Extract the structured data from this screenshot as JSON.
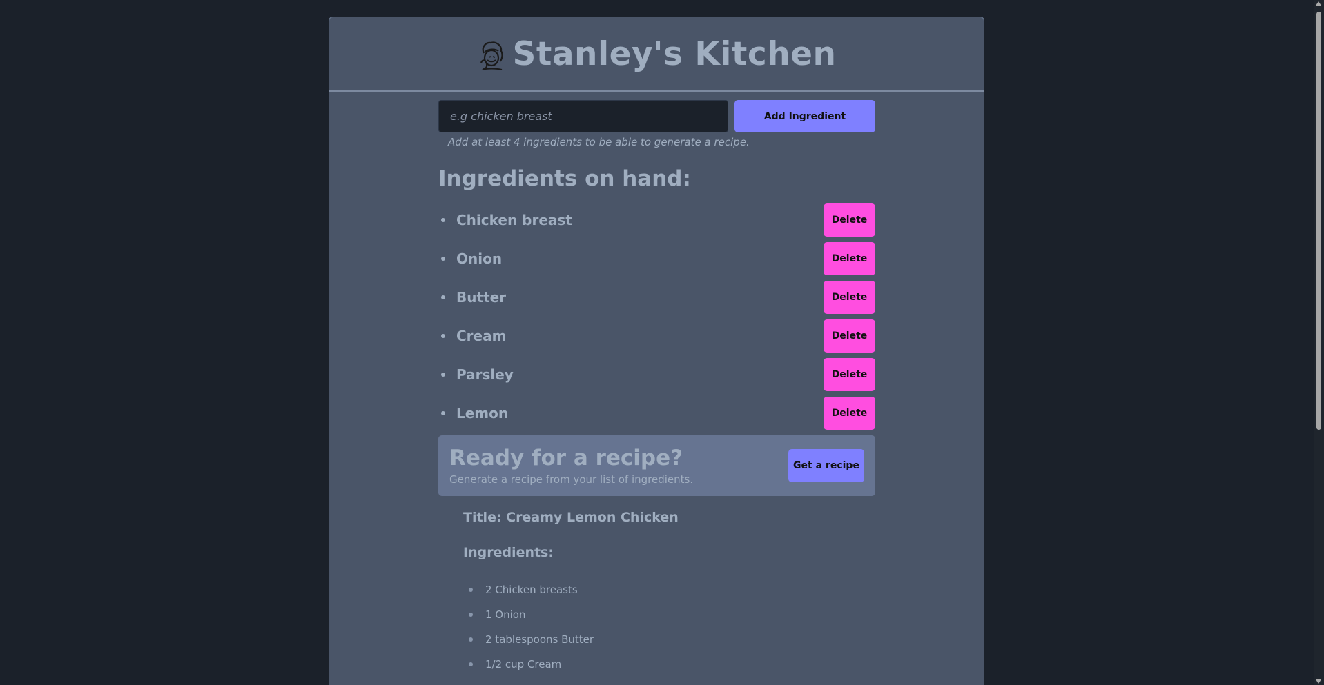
{
  "header": {
    "title": "Stanley's Kitchen",
    "logo_icon": "chef-icon"
  },
  "add_form": {
    "placeholder": "e.g chicken breast",
    "value": "",
    "button_label": "Add Ingredient",
    "hint": "Add at least 4 ingredients to be able to generate a recipe."
  },
  "ingredients": {
    "heading": "Ingredients on hand:",
    "delete_label": "Delete",
    "items": [
      {
        "name": "Chicken breast"
      },
      {
        "name": "Onion"
      },
      {
        "name": "Butter"
      },
      {
        "name": "Cream"
      },
      {
        "name": "Parsley"
      },
      {
        "name": "Lemon"
      }
    ]
  },
  "ready": {
    "title": "Ready for a recipe?",
    "subtitle": "Generate a recipe from your list of ingredients.",
    "button_label": "Get a recipe"
  },
  "recipe": {
    "title": "Title: Creamy Lemon Chicken",
    "ingredients_heading": "Ingredients:",
    "ingredients": [
      "2 Chicken breasts",
      "1 Onion",
      "2 tablespoons Butter",
      "1/2 cup Cream"
    ]
  },
  "colors": {
    "page_bg": "#1b212a",
    "card_bg": "#4a5568",
    "text": "#a0aec0",
    "primary_button": "#7f80ff",
    "delete_button": "#ff4ee0",
    "ready_box": "#667491"
  }
}
